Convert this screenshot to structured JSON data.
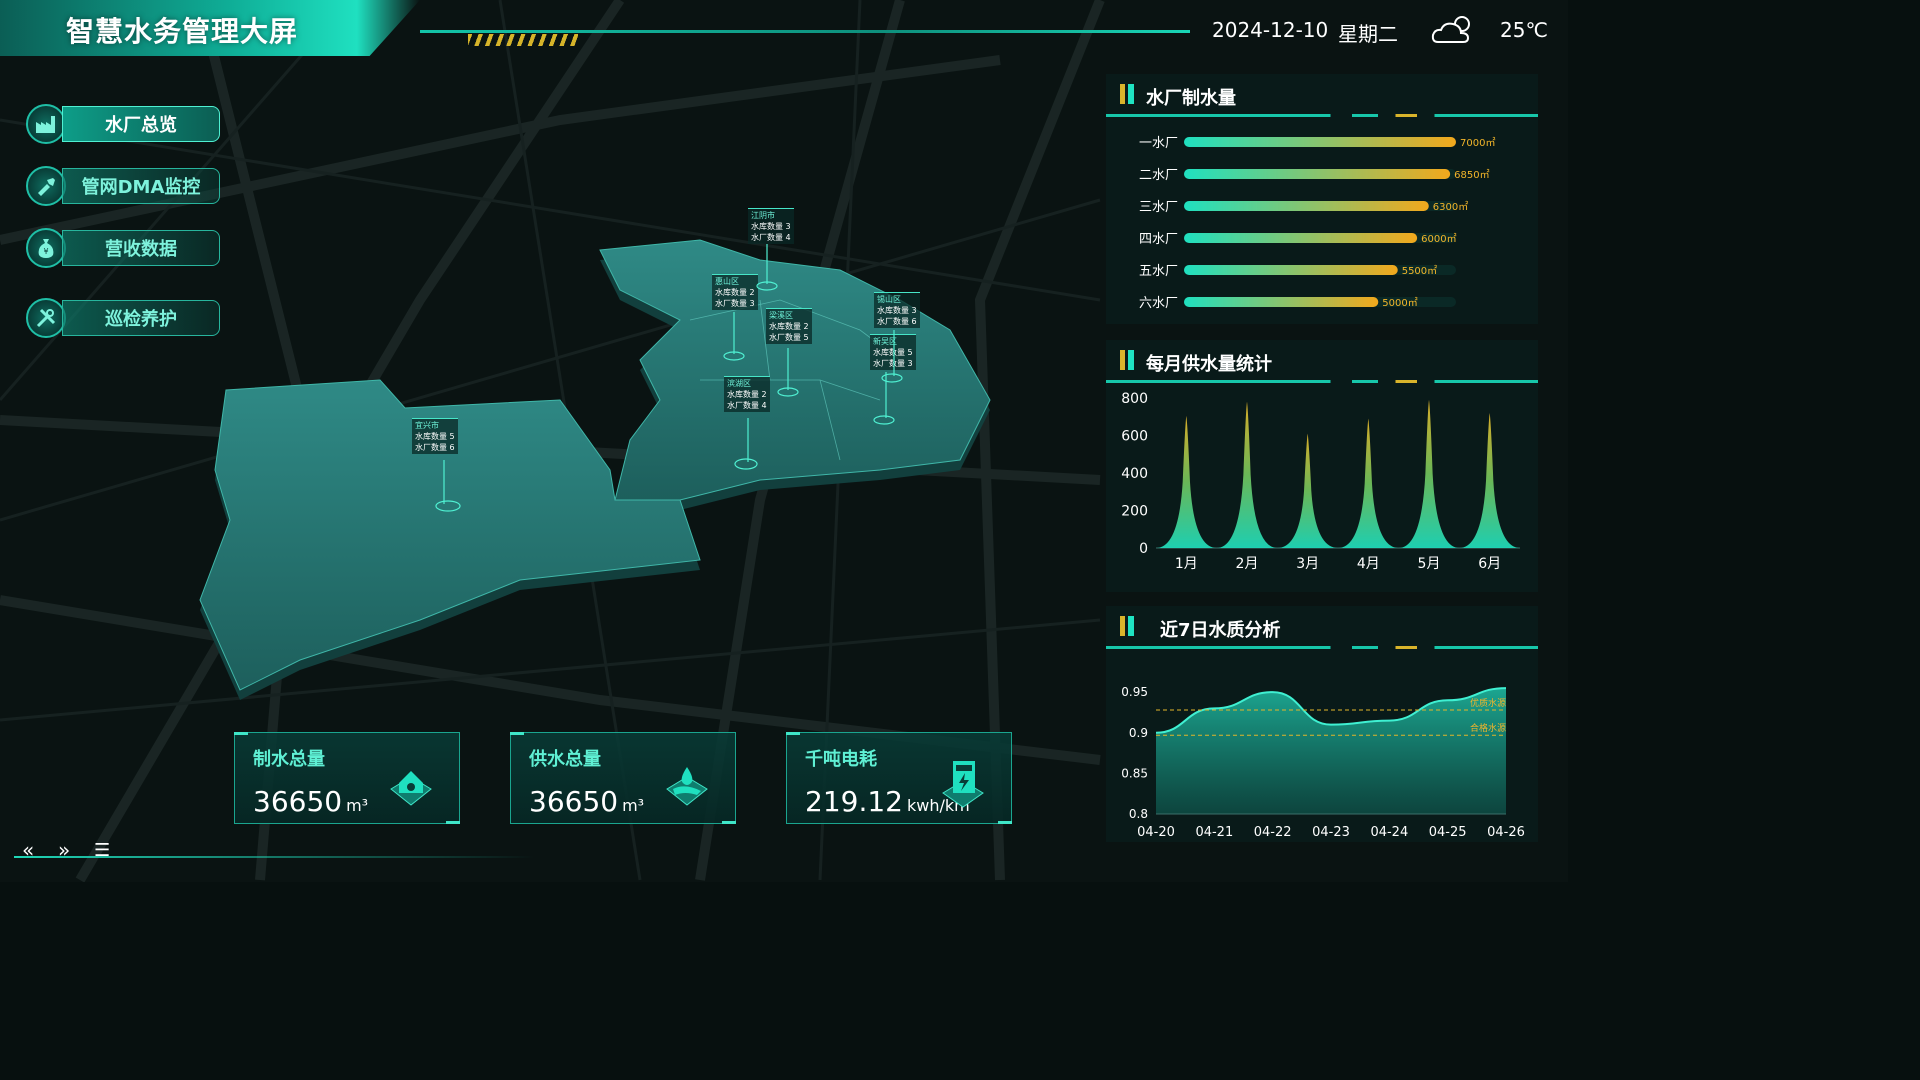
{
  "header": {
    "title": "智慧水务管理大屏",
    "date": "2024-12-10",
    "weekday": "星期二",
    "weather_icon": "cloud-sun-icon",
    "temperature": "25℃"
  },
  "nav": [
    {
      "label": "水厂总览",
      "icon": "factory-icon",
      "active": true
    },
    {
      "label": "管网DMA监控",
      "icon": "pipe-wrench-icon",
      "active": false
    },
    {
      "label": "营收数据",
      "icon": "money-bag-icon",
      "active": false
    },
    {
      "label": "巡检养护",
      "icon": "tools-icon",
      "active": false
    }
  ],
  "map": {
    "regions": [
      {
        "name": "江阴市",
        "line1": "水库数量 3",
        "line2": "水厂数量 4"
      },
      {
        "name": "惠山区",
        "line1": "水库数量 2",
        "line2": "水厂数量 3"
      },
      {
        "name": "梁溪区",
        "line1": "水库数量 2",
        "line2": "水厂数量 5"
      },
      {
        "name": "锡山区",
        "line1": "水库数量 3",
        "line2": "水厂数量 6"
      },
      {
        "name": "新吴区",
        "line1": "水库数量 5",
        "line2": "水厂数量 3"
      },
      {
        "name": "滨湖区",
        "line1": "水库数量 2",
        "line2": "水厂数量 4"
      },
      {
        "name": "宜兴市",
        "line1": "水库数量 5",
        "line2": "水厂数量 6"
      }
    ]
  },
  "stats": [
    {
      "title": "制水总量",
      "value": "36650",
      "unit": "m³",
      "icon": "house-water-icon"
    },
    {
      "title": "供水总量",
      "value": "36650",
      "unit": "m³",
      "icon": "hand-water-drop-icon"
    },
    {
      "title": "千吨电耗",
      "value": "219.12",
      "unit": "kwh/km",
      "icon": "power-meter-icon"
    }
  ],
  "pager": {
    "prev": "«",
    "next": "»",
    "menu": "☰"
  },
  "panels": {
    "production_title": "水厂制水量",
    "monthly_title": "每月供水量统计",
    "quality_title": "近7日水质分析"
  },
  "colors": {
    "accent": "#1fe0c0",
    "gold": "#d9b42b",
    "panel_bg": "#0a1d1c"
  },
  "chart_data": [
    {
      "type": "bar",
      "orientation": "horizontal",
      "categories": [
        "一水厂",
        "二水厂",
        "三水厂",
        "四水厂",
        "五水厂",
        "六水厂"
      ],
      "values": [
        7000,
        6850,
        6300,
        6000,
        5500,
        5000
      ],
      "labels": [
        "7000㎡",
        "6850㎡",
        "6300㎡",
        "6000㎡",
        "5500㎡",
        "5000㎡"
      ],
      "xlim": [
        0,
        7000
      ]
    },
    {
      "type": "area",
      "categories": [
        "1月",
        "2月",
        "3月",
        "4月",
        "5月",
        "6月"
      ],
      "values": [
        705,
        780,
        610,
        690,
        790,
        720
      ],
      "ylim": [
        0,
        800
      ],
      "yticks": [
        0,
        200,
        400,
        600,
        800
      ]
    },
    {
      "type": "area",
      "x": [
        "04-20",
        "04-21",
        "04-22",
        "04-23",
        "04-24",
        "04-25",
        "04-26"
      ],
      "values": [
        0.9,
        0.93,
        0.95,
        0.91,
        0.915,
        0.94,
        0.955
      ],
      "ylim": [
        0.8,
        0.96
      ],
      "yticks": [
        0.8,
        0.85,
        0.9,
        0.95
      ],
      "thresholds": [
        {
          "label": "优质水源",
          "value": 0.928
        },
        {
          "label": "合格水源",
          "value": 0.897
        }
      ]
    }
  ]
}
